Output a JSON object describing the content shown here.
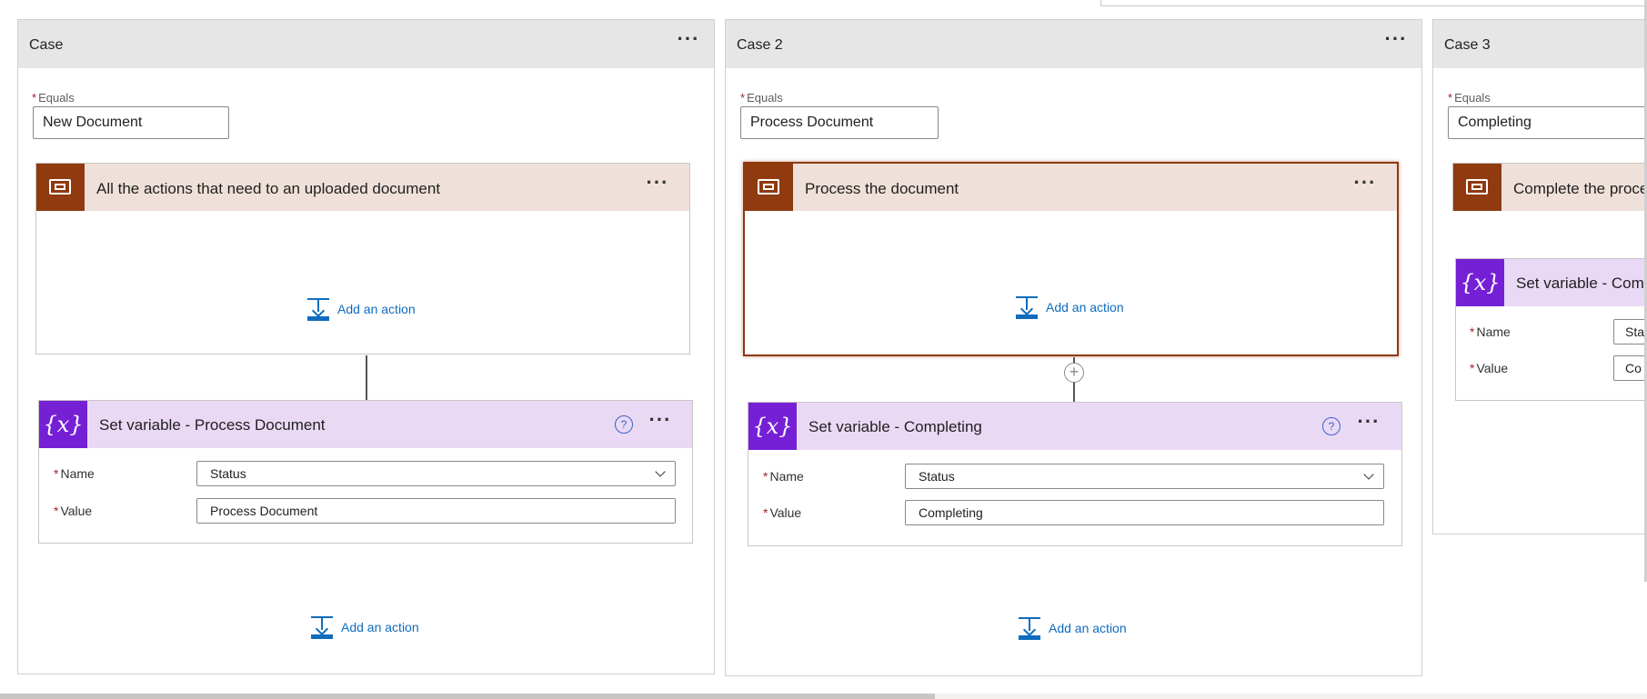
{
  "cases": [
    {
      "title": "Case",
      "equals_label": "Equals",
      "equals_value": "New Document",
      "scope_title": "All the actions that need to an uploaded document",
      "scope_add_action": "Add an action",
      "var_title": "Set variable - Process Document",
      "name_label": "Name",
      "name_value": "Status",
      "value_label": "Value",
      "value_value": "Process Document",
      "bottom_add_action": "Add an action"
    },
    {
      "title": "Case 2",
      "equals_label": "Equals",
      "equals_value": "Process Document",
      "scope_title": "Process the document",
      "scope_add_action": "Add an action",
      "var_title": "Set variable - Completing",
      "name_label": "Name",
      "name_value": "Status",
      "value_label": "Value",
      "value_value": "Completing",
      "bottom_add_action": "Add an action"
    },
    {
      "title": "Case 3",
      "equals_label": "Equals",
      "equals_value": "Completing",
      "scope_title": "Complete the proce",
      "var_title": "Set variable - Comp",
      "name_label": "Name",
      "name_value": "Sta",
      "value_label": "Value",
      "value_value": "Co"
    }
  ],
  "icons": {
    "more": "more-dots-icon",
    "scope": "scope-icon",
    "variable": "variable-icon",
    "help": "help-icon",
    "add_action": "add-action-icon",
    "dropdown": "chevron-down-icon",
    "plus": "plus-icon"
  },
  "colors": {
    "case_header_bg": "#e6e6e6",
    "scope_brand": "#8f3a0f",
    "scope_header_bg": "#efe1da",
    "variable_brand": "#7620d6",
    "variable_header_bg": "#ead9f5",
    "link": "#0f6cbd",
    "required": "#a4262c"
  }
}
